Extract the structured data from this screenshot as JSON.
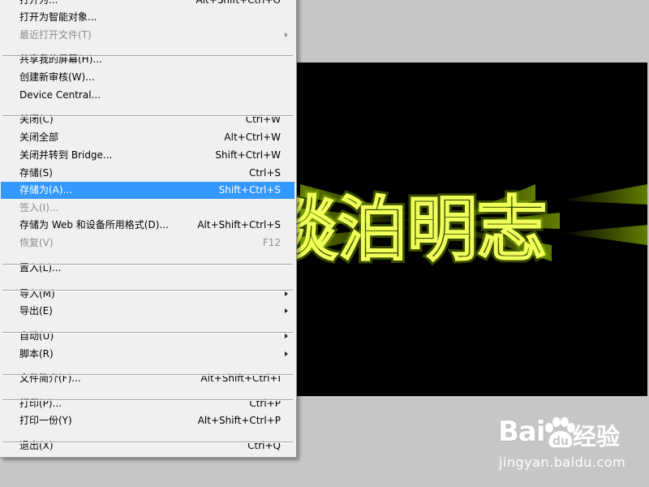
{
  "file_menu": {
    "items": [
      {
        "label": "打开为...",
        "shortcut": "Alt+Shift+Ctrl+O",
        "disabled": false,
        "submenu": false
      },
      {
        "label": "打开为智能对象...",
        "shortcut": "",
        "disabled": false,
        "submenu": false
      },
      {
        "label": "最近打开文件(T)",
        "shortcut": "",
        "disabled": true,
        "submenu": true
      },
      {
        "label": "共享我的屏幕(H)...",
        "shortcut": "",
        "disabled": false,
        "submenu": false
      },
      {
        "label": "创建新审核(W)...",
        "shortcut": "",
        "disabled": false,
        "submenu": false
      },
      {
        "label": "Device Central...",
        "shortcut": "",
        "disabled": false,
        "submenu": false
      },
      {
        "label": "关闭(C)",
        "shortcut": "Ctrl+W",
        "disabled": false,
        "submenu": false
      },
      {
        "label": "关闭全部",
        "shortcut": "Alt+Ctrl+W",
        "disabled": false,
        "submenu": false
      },
      {
        "label": "关闭并转到 Bridge...",
        "shortcut": "Shift+Ctrl+W",
        "disabled": false,
        "submenu": false
      },
      {
        "label": "存储(S)",
        "shortcut": "Ctrl+S",
        "disabled": false,
        "submenu": false
      },
      {
        "label": "存储为(A)...",
        "shortcut": "Shift+Ctrl+S",
        "disabled": false,
        "submenu": false,
        "highlighted": true
      },
      {
        "label": "签入(I)...",
        "shortcut": "",
        "disabled": true,
        "submenu": false
      },
      {
        "label": "存储为 Web 和设备所用格式(D)...",
        "shortcut": "Alt+Shift+Ctrl+S",
        "disabled": false,
        "submenu": false
      },
      {
        "label": "恢复(V)",
        "shortcut": "F12",
        "disabled": true,
        "submenu": false
      },
      {
        "label": "置入(L)...",
        "shortcut": "",
        "disabled": false,
        "submenu": false
      },
      {
        "label": "导入(M)",
        "shortcut": "",
        "disabled": false,
        "submenu": true
      },
      {
        "label": "导出(E)",
        "shortcut": "",
        "disabled": false,
        "submenu": true
      },
      {
        "label": "自动(U)",
        "shortcut": "",
        "disabled": false,
        "submenu": true
      },
      {
        "label": "脚本(R)",
        "shortcut": "",
        "disabled": false,
        "submenu": true
      },
      {
        "label": "文件简介(F)...",
        "shortcut": "Alt+Shift+Ctrl+I",
        "disabled": false,
        "submenu": false
      },
      {
        "label": "打印(P)...",
        "shortcut": "Ctrl+P",
        "disabled": false,
        "submenu": false
      },
      {
        "label": "打印一份(Y)",
        "shortcut": "Alt+Shift+Ctrl+P",
        "disabled": false,
        "submenu": false
      },
      {
        "label": "退出(X)",
        "shortcut": "Ctrl+Q",
        "disabled": false,
        "submenu": false
      }
    ]
  },
  "canvas": {
    "artwork_text": "淡泊明志",
    "glow_color": "#f1ff5a",
    "background_color": "#000000"
  },
  "watermark": {
    "logo": "Bai",
    "logo_suffix": "经验",
    "url": "jingyan.baidu.com",
    "icon": "paw-icon"
  },
  "colors": {
    "highlight": "#3399ff",
    "menu_bg": "#f0f0f0",
    "workspace_bg": "#c6c6c6"
  }
}
